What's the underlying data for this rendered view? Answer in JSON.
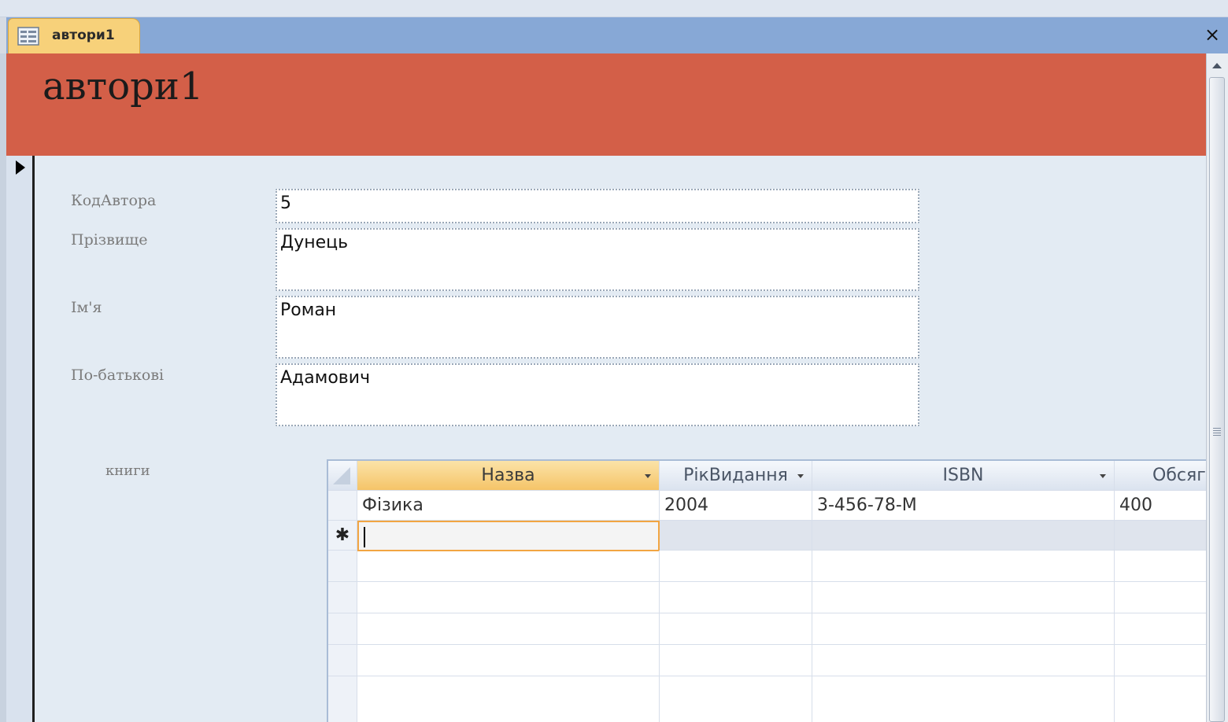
{
  "window": {
    "tab_title": "автори1",
    "close_symbol": "×"
  },
  "form": {
    "title": "автори1",
    "fields": [
      {
        "label": "КодАвтора",
        "value": "5"
      },
      {
        "label": "Прізвище",
        "value": "Дунець"
      },
      {
        "label": "Ім'я",
        "value": "Роман"
      },
      {
        "label": "По-батькові",
        "value": "Адамович"
      }
    ],
    "subform_label": "книги"
  },
  "subform": {
    "columns": [
      "Назва",
      "РікВидання",
      "ISBN",
      "Обсяг"
    ],
    "rows": [
      [
        "Фізика",
        "2004",
        "3-456-78-M",
        "400"
      ]
    ],
    "new_row_marker": "✱"
  },
  "icons": {
    "tab": "form-icon",
    "record_selector": "current-record-arrow-icon",
    "close": "close-icon",
    "scroll_up": "scroll-up-arrow-icon"
  }
}
